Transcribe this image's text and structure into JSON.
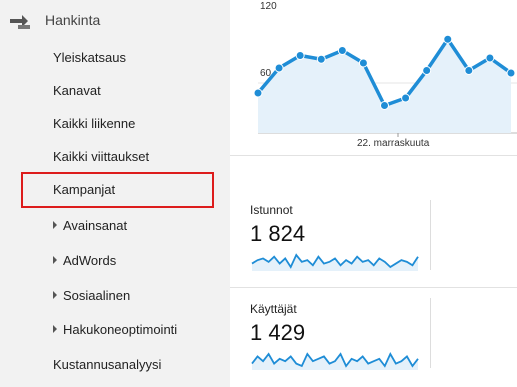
{
  "sidebar": {
    "header": {
      "label": "Hankinta",
      "icon": "acquisition-icon"
    },
    "items": [
      {
        "label": "Yleiskatsaus"
      },
      {
        "label": "Kanavat"
      },
      {
        "label": "Kaikki liikenne"
      },
      {
        "label": "Kaikki viittaukset"
      },
      {
        "label": "Kampanjat",
        "highlighted": true
      }
    ],
    "subitems": [
      {
        "label": "Avainsanat"
      },
      {
        "label": "AdWords"
      },
      {
        "label": "Sosiaalinen"
      },
      {
        "label": "Hakukoneoptimointi"
      }
    ],
    "footer_item": {
      "label": "Kustannusanalyysi"
    },
    "highlight_color": "#dd1c1c"
  },
  "chart_data": {
    "type": "line",
    "y_ticks": [
      "120",
      "60"
    ],
    "x_tick": "22. marraskuuta",
    "series_color": "#1f8dd6",
    "fill_color": "#e5f1fa",
    "values": [
      52,
      72,
      82,
      79,
      86,
      76,
      42,
      48,
      70,
      95,
      70,
      80,
      68
    ]
  },
  "metrics": [
    {
      "label": "Istunnot",
      "value": "1 824",
      "spark": [
        8,
        10,
        11,
        9,
        12,
        8,
        11,
        6,
        13,
        9,
        10,
        7,
        12,
        8,
        9,
        11,
        7,
        10,
        8,
        12,
        9,
        10,
        7,
        11,
        9,
        6,
        8,
        10,
        9,
        7,
        12
      ]
    },
    {
      "label": "Käyttäjät",
      "value": "1 429",
      "spark": [
        8,
        11,
        9,
        12,
        8,
        10,
        9,
        11,
        8,
        7,
        12,
        9,
        10,
        11,
        8,
        9,
        12,
        7,
        10,
        9,
        11,
        8,
        9,
        10,
        7,
        12,
        8,
        9,
        11,
        7,
        10
      ]
    }
  ]
}
